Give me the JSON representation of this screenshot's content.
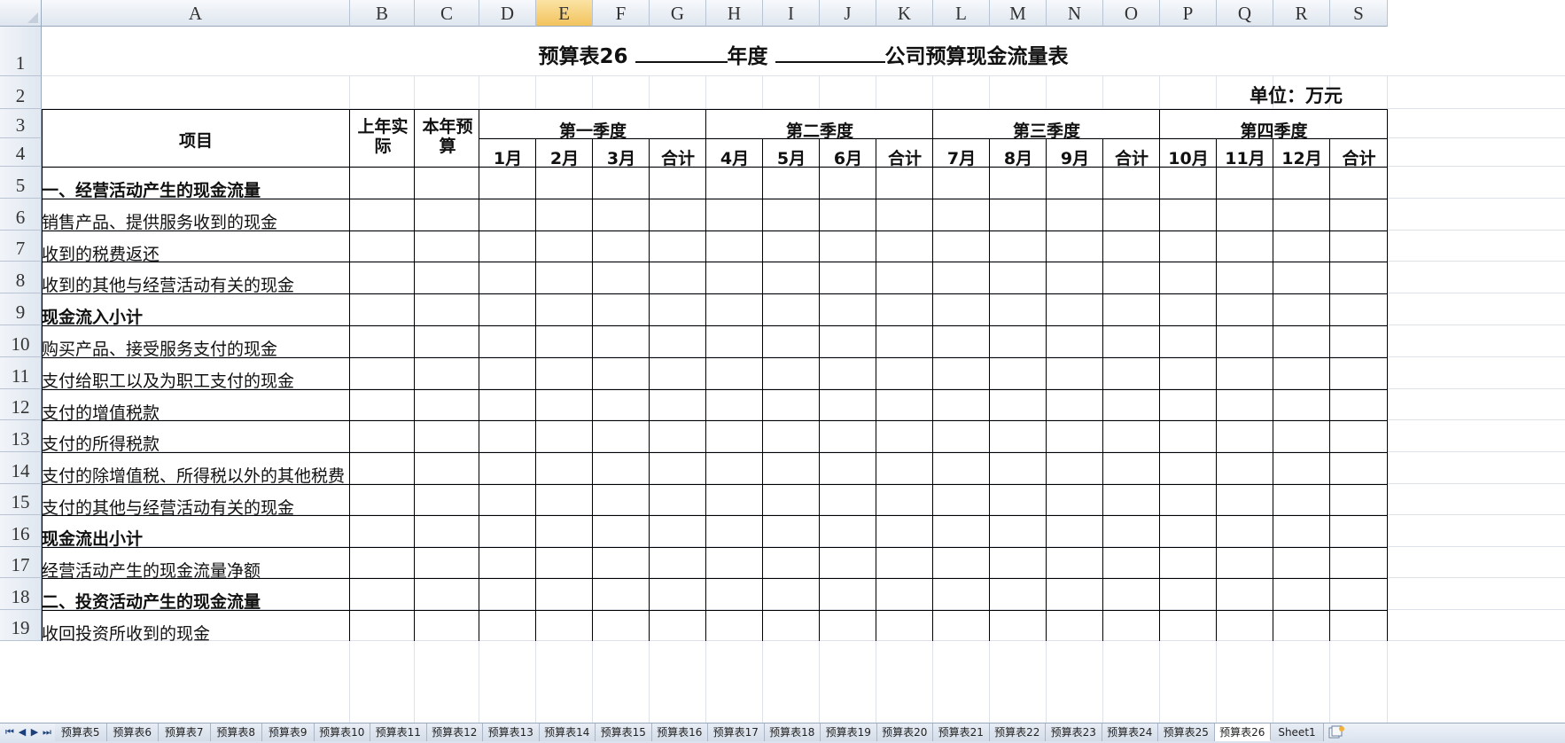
{
  "columns": [
    "A",
    "B",
    "C",
    "D",
    "E",
    "F",
    "G",
    "H",
    "I",
    "J",
    "K",
    "L",
    "M",
    "N",
    "O",
    "P",
    "Q",
    "R",
    "S"
  ],
  "selected_column": "E",
  "rows": [
    "1",
    "2",
    "3",
    "4",
    "5",
    "6",
    "7",
    "8",
    "9",
    "10",
    "11",
    "12",
    "13",
    "14",
    "15",
    "16",
    "17",
    "18",
    "19"
  ],
  "title": {
    "prefix": "预算表26",
    "mid": "年度",
    "suffix": "公司预算现金流量表"
  },
  "unit": "单位：万元",
  "header": {
    "item": "项目",
    "last_year": "上年实际",
    "this_year": "本年预算",
    "quarters": [
      "第一季度",
      "第二季度",
      "第三季度",
      "第四季度"
    ],
    "months": [
      "1月",
      "2月",
      "3月",
      "合计",
      "4月",
      "5月",
      "6月",
      "合计",
      "7月",
      "8月",
      "9月",
      "合计",
      "10月",
      "11月",
      "12月",
      "合计"
    ]
  },
  "line_items": [
    {
      "label": "一、经营活动产生的现金流量",
      "bold": true
    },
    {
      "label": "销售产品、提供服务收到的现金",
      "bold": false
    },
    {
      "label": "收到的税费返还",
      "bold": false
    },
    {
      "label": "收到的其他与经营活动有关的现金",
      "bold": false
    },
    {
      "label": "现金流入小计",
      "bold": true
    },
    {
      "label": "购买产品、接受服务支付的现金",
      "bold": false
    },
    {
      "label": "支付给职工以及为职工支付的现金",
      "bold": false
    },
    {
      "label": "支付的增值税款",
      "bold": false
    },
    {
      "label": "支付的所得税款",
      "bold": false
    },
    {
      "label": "支付的除增值税、所得税以外的其他税费",
      "bold": false
    },
    {
      "label": "支付的其他与经营活动有关的现金",
      "bold": false
    },
    {
      "label": "现金流出小计",
      "bold": true
    },
    {
      "label": "经营活动产生的现金流量净额",
      "bold": false
    },
    {
      "label": "二、投资活动产生的现金流量",
      "bold": true
    },
    {
      "label": "收回投资所收到的现金",
      "bold": false
    }
  ],
  "sheet_tabs": [
    "预算表5",
    "预算表6",
    "预算表7",
    "预算表8",
    "预算表9",
    "预算表10",
    "预算表11",
    "预算表12",
    "预算表13",
    "预算表14",
    "预算表15",
    "预算表16",
    "预算表17",
    "预算表18",
    "预算表19",
    "预算表20",
    "预算表21",
    "预算表22",
    "预算表23",
    "预算表24",
    "预算表25",
    "预算表26",
    "Sheet1"
  ],
  "active_tab": "预算表26",
  "nav_buttons": [
    "⏮",
    "◀",
    "▶",
    "⏭"
  ],
  "icons": {
    "new_sheet": "new-sheet-icon"
  }
}
